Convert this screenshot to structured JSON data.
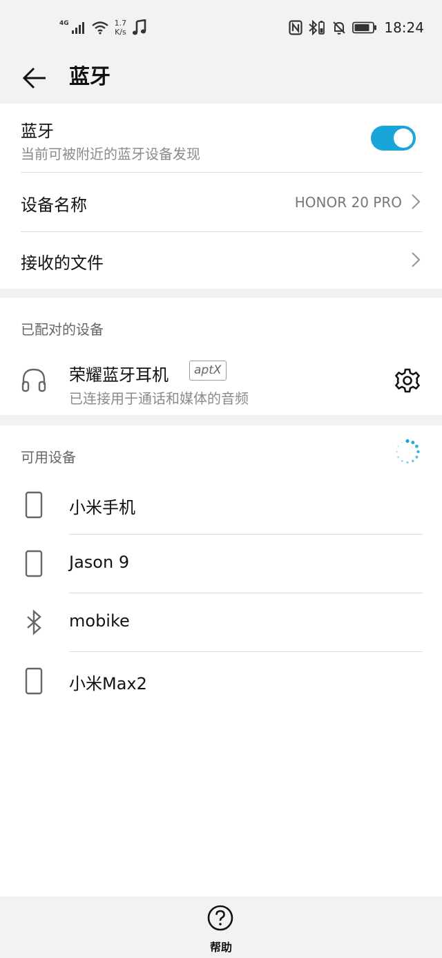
{
  "status_bar": {
    "network_type": "4G",
    "speed_value": "1.7",
    "speed_unit": "K/s",
    "time": "18:24",
    "icons": [
      "signal-icon",
      "wifi-icon",
      "music-icon",
      "nfc-icon",
      "bluetooth-battery-icon",
      "mute-bell-icon",
      "battery-icon"
    ]
  },
  "header": {
    "title": "蓝牙"
  },
  "bluetooth_toggle": {
    "label": "蓝牙",
    "subtitle": "当前可被附近的蓝牙设备发现",
    "enabled": true
  },
  "settings_rows": [
    {
      "label": "设备名称",
      "value": "HONOR 20 PRO"
    },
    {
      "label": "接收的文件",
      "value": ""
    }
  ],
  "paired_section": {
    "title": "已配对的设备",
    "device": {
      "name": "荣耀蓝牙耳机",
      "codec_badge": "aptX",
      "status": "已连接用于通话和媒体的音频",
      "icon": "headset-icon"
    }
  },
  "available_section": {
    "title": "可用设备",
    "scanning": true,
    "devices": [
      {
        "name": "小米手机",
        "icon": "phone-icon"
      },
      {
        "name": "Jason 9",
        "icon": "phone-icon"
      },
      {
        "name": "mobike",
        "icon": "bluetooth-icon"
      },
      {
        "name": "小米Max2",
        "icon": "phone-icon"
      }
    ]
  },
  "bottom_bar": {
    "help_label": "帮助"
  },
  "colors": {
    "accent": "#1aa5d9",
    "background": "#f2f2f2",
    "card": "#ffffff"
  }
}
